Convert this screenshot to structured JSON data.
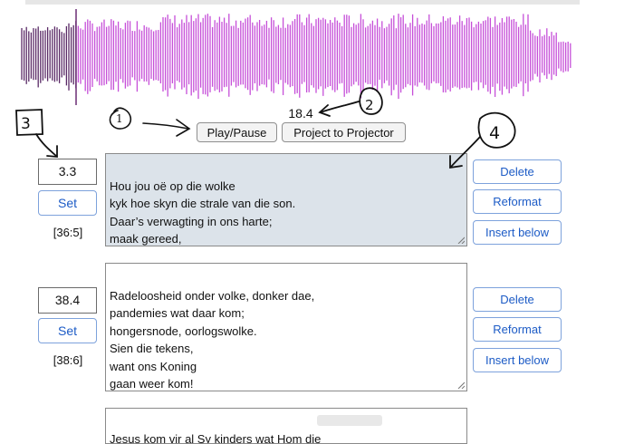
{
  "player": {
    "current_time": "18.4",
    "play_pause_label": "Play/Pause",
    "project_label": "Project to Projector",
    "waveform": {
      "color": "#c64fd8",
      "played_color": "#5a2a66",
      "playhead_color": "#6a2e74"
    }
  },
  "annotations": [
    "1",
    "2",
    "3",
    "4"
  ],
  "slides": [
    {
      "time": "3.3",
      "set_label": "Set",
      "verse": "[36:5]",
      "active": true,
      "lyrics": "Hou jou oë op die wolke\nkyk hoe skyn die strale van die son.\nDaar’s verwagting in ons harte;\nmaak gereed,\nwant ons Koning gaan weer kom!",
      "delete_label": "Delete",
      "reformat_label": "Reformat",
      "insert_label": "Insert below"
    },
    {
      "time": "38.4",
      "set_label": "Set",
      "verse": "[38:6]",
      "active": false,
      "lyrics": "Radeloosheid onder volke, donker dae,\npandemies wat daar kom;\nhongersnode, oorlogswolke.\nSien die tekens,\nwant ons Koning\ngaan weer kom!",
      "delete_label": "Delete",
      "reformat_label": "Reformat",
      "insert_label": "Insert below"
    },
    {
      "lyrics": "Jesus kom vir al Sy kinders wat Hom die"
    }
  ],
  "colors": {
    "active_slide_bg": "#dce3ea",
    "button_text": "#1c5bc6",
    "button_border": "#7da2dc"
  }
}
